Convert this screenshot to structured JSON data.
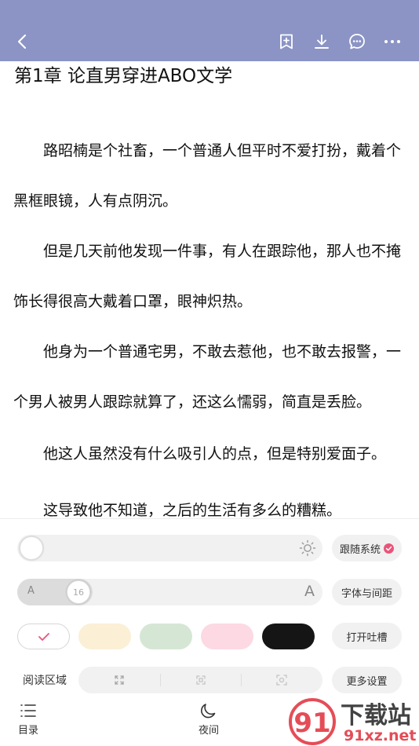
{
  "toolbar": {
    "back_icon": "chevron-left-icon",
    "bookmark_icon": "bookmark-add-icon",
    "download_icon": "download-icon",
    "comment_icon": "comment-icon",
    "more_icon": "more-icon"
  },
  "reader": {
    "chapter_title": "第1章 论直男穿进ABO文学",
    "paragraphs": [
      "路昭楠是个社畜，一个普通人但平时不爱打扮，戴着个黑框眼镜，人有点阴沉。",
      "但是几天前他发现一件事，有人在跟踪他，那人也不掩饰长得很高大戴着口罩，眼神炽热。",
      "他身为一个普通宅男，不敢去惹他，也不敢去报警，一个男人被男人跟踪就算了，还这么懦弱，简直是丢脸。",
      "他这人虽然没有什么吸引人的点，但是特别爱面子。",
      "这导致他不知道，之后的生活有多么的糟糕。"
    ]
  },
  "settings": {
    "brightness": {
      "level": 0.0,
      "follow_system_label": "跟随系统"
    },
    "font": {
      "small_label": "A",
      "large_label": "A",
      "size_value": "16",
      "font_spacing_label": "字体与间距"
    },
    "themes": {
      "colors": [
        "#ffffff",
        "#fbefd6",
        "#d6e6d5",
        "#fcd9e3",
        "#151515"
      ],
      "selected": 0,
      "check_color": "#e8557a",
      "open_tucao_label": "打开吐槽"
    },
    "reading_area": {
      "label": "阅读区域",
      "options": [
        "expand-icon",
        "fullscreen-icon",
        "focus-area-icon"
      ],
      "more_settings_label": "更多设置"
    }
  },
  "bottom_nav": {
    "items": [
      {
        "label": "目录",
        "icon": "list-icon"
      },
      {
        "label": "夜间",
        "icon": "moon-icon"
      }
    ]
  },
  "watermark": {
    "brand_cn": "下载站",
    "brand_url": "91xz.net",
    "logo_num": "91"
  },
  "colors": {
    "toolbar_bg": "#8b94c5",
    "accent": "#e8557a",
    "panel_control_bg": "#f1f1f1"
  }
}
